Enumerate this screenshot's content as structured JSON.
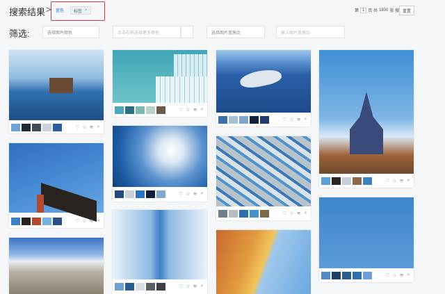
{
  "header": {
    "title": "搜索结果",
    "separator": ">",
    "color_chip": "蓝色",
    "tag_chip": "标签",
    "tag_close": "×",
    "pager_prefix": "第",
    "page_number": "1",
    "pager_mid": "页 共",
    "total_results": "1800",
    "pager_suffix": "张 搜索结果",
    "reset_label": "重置"
  },
  "filters": {
    "label": "筛选:",
    "color_select": "选择图片颜色",
    "multi_color_placeholder": "点击右侧选择更多颜色",
    "ratio_select": "选择图片宽高比",
    "ratio_input_placeholder": "输入图片宽高比"
  },
  "card_icons": [
    "heart-icon",
    "star-icon",
    "rss-icon",
    "search-icon"
  ],
  "cards": [
    {
      "name": "lake-hut",
      "colors": [
        "#6fa3d6",
        "#1f2a33",
        "#3f4d55",
        "#c9d3dc",
        "#2a5d9a"
      ]
    },
    {
      "name": "sky-building",
      "colors": [
        "#49a9b9",
        "#2c6f80",
        "#7fb8ad",
        "#b7d3cc",
        "#6d5a4d"
      ]
    },
    {
      "name": "whale",
      "colors": [
        "#3c6ea8",
        "#a9bfd4",
        "#7fa6cc",
        "#13213a",
        "#1e3c6b"
      ]
    },
    {
      "name": "temple",
      "colors": [
        "#58a0d6",
        "#2a2421",
        "#c7cfd6",
        "#8c6848",
        "#3e82c0"
      ]
    },
    {
      "name": "red-building",
      "colors": [
        "#3e7fc6",
        "#2a211f",
        "#b34a30",
        "#74b2e0",
        "#2a4f86"
      ]
    },
    {
      "name": "sunbeam-clouds",
      "colors": [
        "#234a7c",
        "#c9cfd4",
        "#2d72c0",
        "#0f1f3a",
        "#7fa9cc"
      ]
    },
    {
      "name": "prayer-flags",
      "colors": [
        "#6f7f92",
        "#b5bec5",
        "#2d6fa8",
        "#4591c9",
        "#7a6a4a"
      ]
    },
    {
      "name": "snow-mountain",
      "colors": []
    },
    {
      "name": "glass-tower",
      "colors": [
        "#6da2d8",
        "#2a5d96",
        "#d7dde2",
        "#5a6068",
        "#3b3f46"
      ]
    },
    {
      "name": "orange-buildings",
      "colors": []
    },
    {
      "name": "birds-sky",
      "colors": [
        "#4f8cc9",
        "#1f3f6a",
        "#2a5c92",
        "#2e6fb2",
        "#6f9fd8"
      ]
    }
  ]
}
